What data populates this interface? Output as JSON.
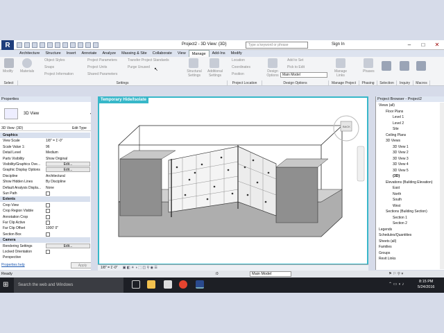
{
  "titlebar": {
    "app_letter": "R",
    "title": "Project2 - 3D View: {3D}",
    "search_placeholder": "Type a keyword or phrase",
    "sign_in": "Sign In"
  },
  "tabs": [
    "Architecture",
    "Structure",
    "Insert",
    "Annotate",
    "Analyze",
    "Massing & Site",
    "Collaborate",
    "View",
    "Manage",
    "Add-Ins",
    "Modify"
  ],
  "active_tab": "Manage",
  "ribbon": {
    "modify": "Modify",
    "materials": "Materials",
    "object_styles": "Object Styles",
    "snaps": "Snaps",
    "project_information": "Project Information",
    "project_parameters": "Project Parameters",
    "project_units": "Project Units",
    "shared_parameters": "Shared Parameters",
    "transfer_standards": "Transfer Project Standards",
    "purge_unused": "Purge Unused",
    "structural_settings": "Structural Settings",
    "additional_settings": "Additional Settings",
    "location": "Location",
    "coordinates": "Coordinates",
    "position": "Position",
    "design_options": "Design Options",
    "add_to_set": "Add to Set",
    "pick_to_edit": "Pick to Edit",
    "main_model": "Main Model",
    "manage_links": "Manage Links",
    "phases": "Phases",
    "selection": "Selection",
    "inquiry": "Inquiry",
    "macros": "Macros"
  },
  "panels": {
    "select": "Select",
    "settings": "Settings",
    "project_location": "Project Location",
    "design_options": "Design Options",
    "manage_project": "Manage Project",
    "phasing": "Phasing",
    "selection": "Selection",
    "inquiry": "Inquiry",
    "macros": "Macros"
  },
  "properties": {
    "header": "Properties",
    "type_name": "3D View",
    "instance": "3D View: {3D}",
    "edit_type": "Edit Type",
    "rows": [
      {
        "k": "Graphics",
        "v": "",
        "cat": true
      },
      {
        "k": "View Scale",
        "v": "1/8\" = 1'-0\""
      },
      {
        "k": "Scale Value    1:",
        "v": "96"
      },
      {
        "k": "Detail Level",
        "v": "Medium"
      },
      {
        "k": "Parts Visibility",
        "v": "Show Original"
      },
      {
        "k": "Visibility/Graphics Ove...",
        "v": "Edit...",
        "btn": true
      },
      {
        "k": "Graphic Display Options",
        "v": "Edit...",
        "btn": true
      },
      {
        "k": "Discipline",
        "v": "Architectural"
      },
      {
        "k": "Show Hidden Lines",
        "v": "By Discipline"
      },
      {
        "k": "Default Analysis Displa...",
        "v": "None"
      },
      {
        "k": "Sun Path",
        "v": "",
        "cb": true
      },
      {
        "k": "Extents",
        "v": "",
        "cat": true
      },
      {
        "k": "Crop View",
        "v": "",
        "cb": true
      },
      {
        "k": "Crop Region Visible",
        "v": "",
        "cb": true
      },
      {
        "k": "Annotation Crop",
        "v": "",
        "cb": true
      },
      {
        "k": "Far Clip Active",
        "v": "",
        "cb": true
      },
      {
        "k": "Far Clip Offset",
        "v": "1000' 0\""
      },
      {
        "k": "Section Box",
        "v": "",
        "cb": true
      },
      {
        "k": "Camera",
        "v": "",
        "cat": true
      },
      {
        "k": "Rendering Settings",
        "v": "Edit...",
        "btn": true
      },
      {
        "k": "Locked Orientation",
        "v": "",
        "cb": true
      },
      {
        "k": "Perspective",
        "v": ""
      }
    ],
    "help": "Properties help",
    "apply": "Apply"
  },
  "view": {
    "label": "Temporary Hide/Isolate",
    "scale": "1/8\" = 1'-0\"",
    "cube_label": "BACK"
  },
  "browser": {
    "header": "Project Browser - Project2",
    "items": [
      {
        "t": "Views (all)",
        "d": 0
      },
      {
        "t": "Floor Plans",
        "d": 1
      },
      {
        "t": "Level 1",
        "d": 2
      },
      {
        "t": "Level 2",
        "d": 2
      },
      {
        "t": "Site",
        "d": 2
      },
      {
        "t": "Ceiling Plans",
        "d": 1
      },
      {
        "t": "3D Views",
        "d": 1
      },
      {
        "t": "3D View 1",
        "d": 2
      },
      {
        "t": "3D View 2",
        "d": 2
      },
      {
        "t": "3D View 3",
        "d": 2
      },
      {
        "t": "3D View 4",
        "d": 2
      },
      {
        "t": "3D View 5",
        "d": 2
      },
      {
        "t": "{3D}",
        "d": 2,
        "b": true
      },
      {
        "t": "Elevations (Building Elevation)",
        "d": 1
      },
      {
        "t": "East",
        "d": 2
      },
      {
        "t": "North",
        "d": 2
      },
      {
        "t": "South",
        "d": 2
      },
      {
        "t": "West",
        "d": 2
      },
      {
        "t": "Sections (Building Section)",
        "d": 1
      },
      {
        "t": "Section 1",
        "d": 2
      },
      {
        "t": "Section 2",
        "d": 2
      },
      {
        "t": "Legends",
        "d": 0
      },
      {
        "t": "Schedules/Quantities",
        "d": 0
      },
      {
        "t": "Sheets (all)",
        "d": 0
      },
      {
        "t": "Families",
        "d": 0
      },
      {
        "t": "Groups",
        "d": 0
      },
      {
        "t": "Revit Links",
        "d": 0
      }
    ]
  },
  "status": {
    "text": "Ready",
    "zero": ":0",
    "model": "Main Model"
  },
  "taskbar": {
    "search": "Search the web and Windows",
    "time": "8:15 PM",
    "date": "5/24/2016"
  },
  "colors": {
    "accent": "#37b7c9",
    "revit_blue": "#1f3e7c"
  }
}
